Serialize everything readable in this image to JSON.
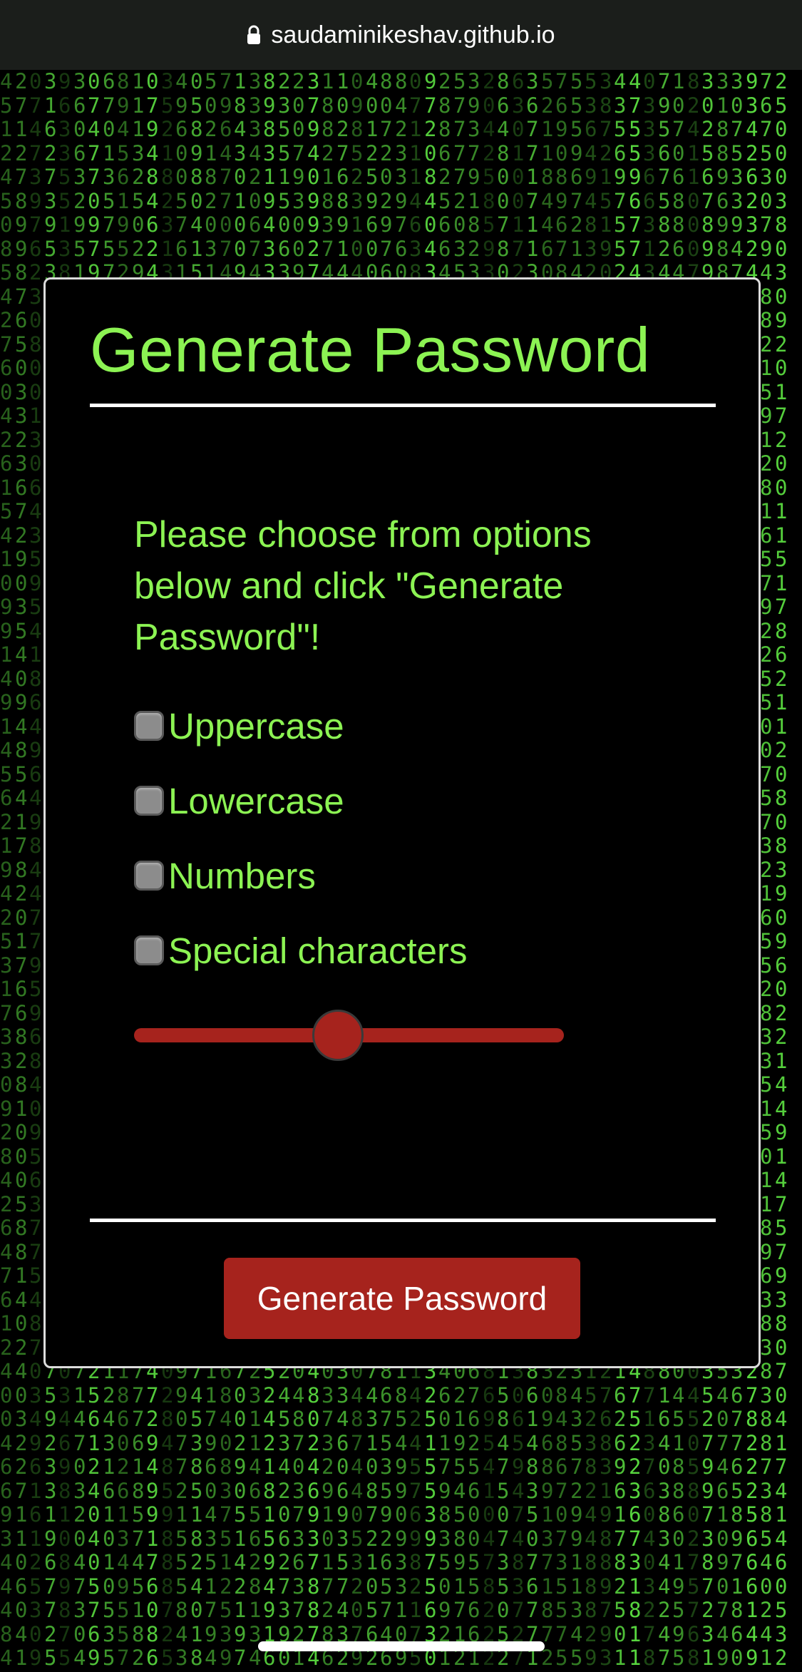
{
  "browser": {
    "url": "saudaminikeshav.github.io",
    "lock_icon": "lock-icon"
  },
  "card": {
    "title": "Generate Password",
    "instructions": "Please choose from options below and click \"Generate Password\"!",
    "options": [
      {
        "label": "Uppercase",
        "checked": false
      },
      {
        "label": "Lowercase",
        "checked": false
      },
      {
        "label": "Numbers",
        "checked": false
      },
      {
        "label": "Special characters",
        "checked": false
      }
    ],
    "slider": {
      "level": 0.47
    },
    "button_label": "Generate Password"
  },
  "colors": {
    "accent_green": "#8cf353",
    "button_red": "#a6231d",
    "matrix_green": "#59d83f",
    "background": "#000000"
  }
}
